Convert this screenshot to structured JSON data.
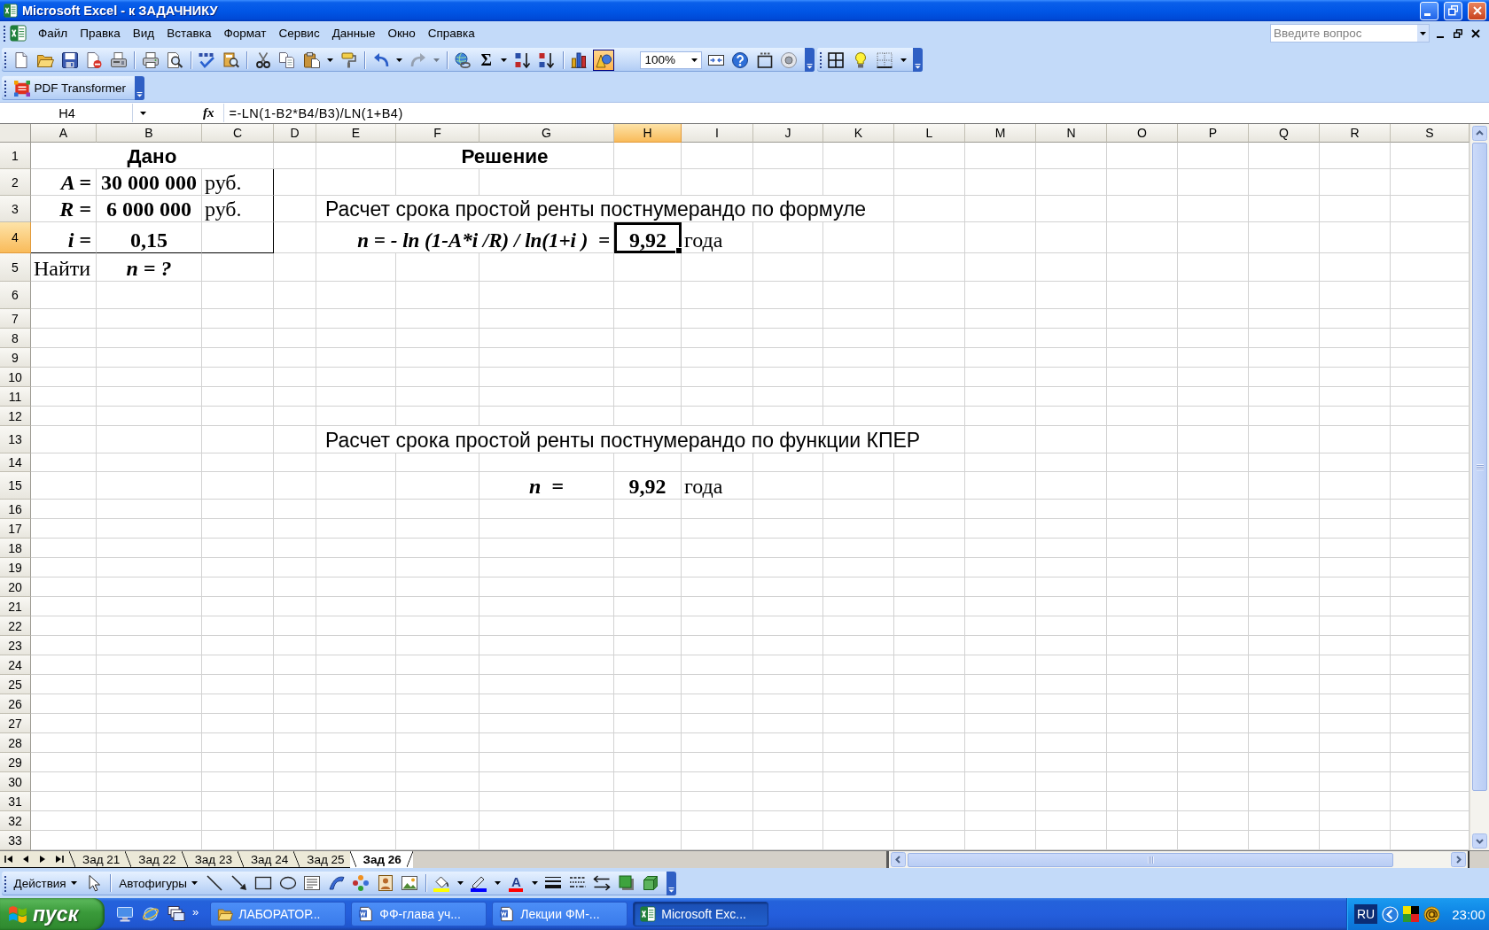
{
  "window": {
    "title": "Microsoft Excel - к ЗАДАЧНИКУ"
  },
  "menu_bar": {
    "items": [
      "Файл",
      "Правка",
      "Вид",
      "Вставка",
      "Формат",
      "Сервис",
      "Данные",
      "Окно",
      "Справка"
    ],
    "help_box": {
      "placeholder": "Введите вопрос"
    }
  },
  "toolbar_rows": [
    {
      "bands": [
        {
          "items": [
            {
              "kind": "new",
              "pressed": false,
              "disabled": false
            },
            {
              "kind": "open",
              "pressed": false,
              "disabled": false
            },
            {
              "kind": "save",
              "pressed": false,
              "disabled": false
            },
            {
              "kind": "permission",
              "pressed": false,
              "disabled": false
            },
            {
              "kind": "fax",
              "pressed": false,
              "disabled": false
            },
            {
              "kind": "separator"
            },
            {
              "kind": "print",
              "pressed": false,
              "disabled": false
            },
            {
              "kind": "preview",
              "pressed": false,
              "disabled": false
            },
            {
              "kind": "separator"
            },
            {
              "kind": "spelling",
              "pressed": false,
              "disabled": false
            },
            {
              "kind": "research",
              "pressed": false,
              "disabled": false
            },
            {
              "kind": "separator"
            },
            {
              "kind": "cut",
              "pressed": false,
              "disabled": false
            },
            {
              "kind": "copy",
              "pressed": false,
              "disabled": false
            },
            {
              "kind": "paste",
              "pressed": false,
              "disabled": false
            },
            {
              "kind": "dropdown",
              "disabled": false
            },
            {
              "kind": "painter",
              "pressed": false,
              "disabled": false
            },
            {
              "kind": "separator"
            },
            {
              "kind": "undo",
              "pressed": false,
              "disabled": false
            },
            {
              "kind": "dropdown",
              "disabled": false
            },
            {
              "kind": "redo",
              "pressed": false,
              "disabled": true
            },
            {
              "kind": "dropdown",
              "disabled": true
            },
            {
              "kind": "separator"
            },
            {
              "kind": "hyperlink",
              "pressed": false,
              "disabled": false
            },
            {
              "kind": "autosum",
              "label": "Σ",
              "pressed": false,
              "disabled": false
            },
            {
              "kind": "dropdown",
              "disabled": false
            },
            {
              "kind": "sortup",
              "pressed": false,
              "disabled": false
            },
            {
              "kind": "sortdown",
              "pressed": false,
              "disabled": false
            },
            {
              "kind": "separator"
            },
            {
              "kind": "chart",
              "pressed": false,
              "disabled": false
            },
            {
              "kind": "drawing",
              "pressed": true,
              "disabled": false
            },
            {
              "kind": "zoom",
              "value": "100%"
            },
            {
              "kind": "framearrows",
              "pressed": false,
              "disabled": false
            },
            {
              "kind": "help",
              "pressed": false,
              "disabled": false
            },
            {
              "kind": "frame",
              "pressed": false,
              "disabled": false
            },
            {
              "kind": "target",
              "pressed": false,
              "disabled": false
            }
          ]
        },
        {
          "items": [
            {
              "kind": "grid",
              "pressed": false,
              "disabled": false
            },
            {
              "kind": "bulb",
              "pressed": false,
              "disabled": false
            },
            {
              "kind": "borders",
              "pressed": false,
              "disabled": false
            },
            {
              "kind": "dropdown",
              "disabled": false
            }
          ]
        }
      ]
    },
    {
      "bands": [
        {
          "items": [
            {
              "kind": "pdf",
              "label": "PDF Transformer"
            }
          ]
        }
      ]
    }
  ],
  "formula_bar": {
    "name_box": "H4",
    "function_label": "fx",
    "formula": "=-LN(1-B2*B4/B3)/LN(1+B4)"
  },
  "sheet": {
    "columns": [
      {
        "label": "A",
        "selected": false
      },
      {
        "label": "B",
        "selected": false
      },
      {
        "label": "C",
        "selected": false
      },
      {
        "label": "D",
        "selected": false
      },
      {
        "label": "E",
        "selected": false
      },
      {
        "label": "F",
        "selected": false
      },
      {
        "label": "G",
        "selected": false
      },
      {
        "label": "H",
        "selected": true
      },
      {
        "label": "I",
        "selected": false
      },
      {
        "label": "J",
        "selected": false
      },
      {
        "label": "K",
        "selected": false
      },
      {
        "label": "L",
        "selected": false
      },
      {
        "label": "M",
        "selected": false
      },
      {
        "label": "N",
        "selected": false
      },
      {
        "label": "O",
        "selected": false
      },
      {
        "label": "P",
        "selected": false
      },
      {
        "label": "Q",
        "selected": false
      },
      {
        "label": "R",
        "selected": false
      },
      {
        "label": "S",
        "selected": false
      }
    ],
    "rows": [
      {
        "label": "1",
        "selected": false,
        "cells": [
          {
            "text": "Дано",
            "kind": "heading",
            "selected": false
          },
          {
            "kind": "merged"
          },
          {
            "kind": "merged"
          },
          null,
          null,
          {
            "text": "Решение",
            "kind": "heading",
            "selected": false
          },
          {
            "kind": "merged"
          }
        ]
      },
      {
        "label": "2",
        "selected": false,
        "cells": [
          {
            "text": "A =",
            "kind": "label",
            "selected": false
          },
          {
            "text": "30 000 000",
            "kind": "number",
            "selected": false
          },
          {
            "text": "руб.",
            "kind": "text",
            "selected": false,
            "border_right": true
          }
        ]
      },
      {
        "label": "3",
        "selected": false,
        "cells": [
          {
            "text": "R =",
            "kind": "label",
            "selected": false
          },
          {
            "text": "6 000 000",
            "kind": "number",
            "selected": false
          },
          {
            "text": "руб.",
            "kind": "text",
            "selected": false,
            "border_right": true
          },
          null,
          {
            "text": "Расчет срока простой ренты постнумерандо по формуле",
            "kind": "note",
            "selected": false
          }
        ]
      },
      {
        "label": "4",
        "selected": true,
        "cells": [
          {
            "text": "i =",
            "kind": "label",
            "selected": false,
            "border_bottom": true
          },
          {
            "text": "0,15",
            "kind": "number",
            "selected": false,
            "border_bottom": true
          },
          {
            "kind": "blank",
            "selected": false,
            "border_right": true,
            "border_bottom": true
          },
          null,
          null,
          null,
          {
            "text": "n = - ln (1-A*i /R) / ln(1+i )  =",
            "kind": "formula",
            "selected": false
          },
          {
            "text": "9,92",
            "kind": "number",
            "selected": true
          },
          {
            "text": "года",
            "kind": "text",
            "selected": false
          }
        ]
      },
      {
        "label": "5",
        "selected": false,
        "cells": [
          {
            "text": "Найти",
            "kind": "text",
            "selected": false
          },
          {
            "text": "n = ?",
            "kind": "query",
            "selected": false
          }
        ]
      },
      {
        "label": "6",
        "selected": false
      },
      {
        "label": "7",
        "selected": false
      },
      {
        "label": "8",
        "selected": false
      },
      {
        "label": "9",
        "selected": false
      },
      {
        "label": "10",
        "selected": false
      },
      {
        "label": "11",
        "selected": false
      },
      {
        "label": "12",
        "selected": false
      },
      {
        "label": "13",
        "selected": false,
        "cells": [
          null,
          null,
          null,
          null,
          {
            "text": "Расчет срока простой ренты постнумерандо по функции КПЕР",
            "kind": "note",
            "selected": false
          }
        ]
      },
      {
        "label": "14",
        "selected": false
      },
      {
        "label": "15",
        "selected": false,
        "cells": [
          null,
          null,
          null,
          null,
          null,
          null,
          {
            "text": "n  =",
            "kind": "query",
            "selected": false
          },
          {
            "text": "9,92",
            "kind": "number",
            "selected": false
          },
          {
            "text": "года",
            "kind": "text",
            "selected": false
          }
        ]
      },
      {
        "label": "16",
        "selected": false
      },
      {
        "label": "17",
        "selected": false
      },
      {
        "label": "18",
        "selected": false
      },
      {
        "label": "19",
        "selected": false
      },
      {
        "label": "20",
        "selected": false
      },
      {
        "label": "21",
        "selected": false
      },
      {
        "label": "22",
        "selected": false
      },
      {
        "label": "23",
        "selected": false
      },
      {
        "label": "24",
        "selected": false
      },
      {
        "label": "25",
        "selected": false
      },
      {
        "label": "26",
        "selected": false
      },
      {
        "label": "27",
        "selected": false
      },
      {
        "label": "28",
        "selected": false
      },
      {
        "label": "29",
        "selected": false
      },
      {
        "label": "30",
        "selected": false
      },
      {
        "label": "31",
        "selected": false
      },
      {
        "label": "32",
        "selected": false
      },
      {
        "label": "33",
        "selected": false
      }
    ]
  },
  "sheet_tabs": [
    {
      "label": "Зад 21",
      "selected": false
    },
    {
      "label": "Зад 22",
      "selected": false
    },
    {
      "label": "Зад 23",
      "selected": false
    },
    {
      "label": "Зад 24",
      "selected": false
    },
    {
      "label": "Зад 25",
      "selected": false
    },
    {
      "label": "Зад 26",
      "selected": true
    }
  ],
  "drawing_toolbar": {
    "items": [
      {
        "kind": "menu",
        "label": "Действия"
      },
      {
        "kind": "pointer"
      },
      {
        "kind": "separator"
      },
      {
        "kind": "menu",
        "label": "Автофигуры"
      },
      {
        "kind": "line"
      },
      {
        "kind": "arrow"
      },
      {
        "kind": "rectangle"
      },
      {
        "kind": "oval"
      },
      {
        "kind": "textbox"
      },
      {
        "kind": "wordart"
      },
      {
        "kind": "diagram"
      },
      {
        "kind": "clipart"
      },
      {
        "kind": "picture"
      },
      {
        "kind": "separator"
      },
      {
        "kind": "fill"
      },
      {
        "kind": "dropdown"
      },
      {
        "kind": "pen"
      },
      {
        "kind": "dropdown"
      },
      {
        "kind": "fontcolor",
        "label": "A"
      },
      {
        "kind": "dropdown"
      },
      {
        "kind": "linestyle"
      },
      {
        "kind": "dashstyle"
      },
      {
        "kind": "arrowstyle"
      },
      {
        "kind": "shadow"
      },
      {
        "kind": "cube"
      }
    ]
  },
  "taskbar": {
    "start": "пуск",
    "more": "»",
    "tasks": [
      {
        "kind": "folder",
        "label": "ЛАБОРАТОР...",
        "selected": false
      },
      {
        "kind": "document",
        "label": "ФФ-глава уч...",
        "selected": false
      },
      {
        "kind": "document",
        "label": "Лекции ФМ-...",
        "selected": false
      },
      {
        "kind": "spreadsheet",
        "label": "Microsoft Exc...",
        "selected": true
      }
    ],
    "language": "RU",
    "clock": "23:00"
  }
}
